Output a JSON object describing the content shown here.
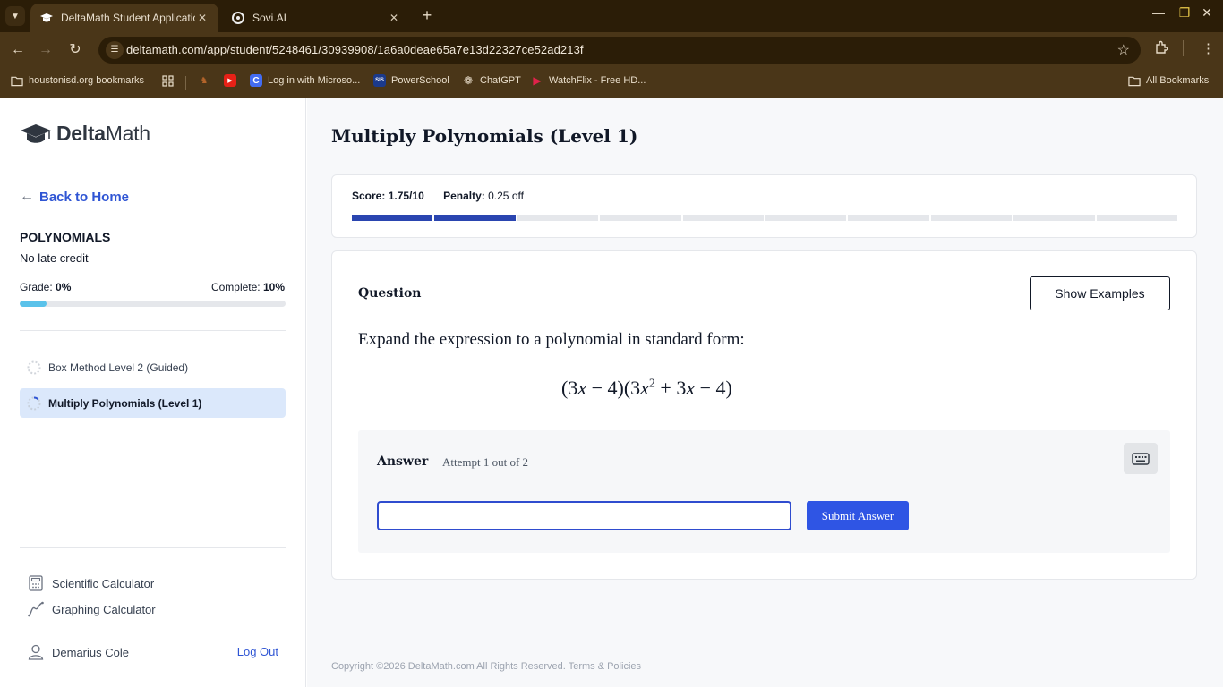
{
  "browser": {
    "tabs": [
      {
        "title": "DeltaMath Student Application",
        "active": true,
        "icon": "graduation-cap-icon"
      },
      {
        "title": "Sovi.AI",
        "active": false,
        "icon": "sovi-logo-icon"
      }
    ],
    "new_tab": "+",
    "url": "deltamath.com/app/student/5248461/30939908/1a6a0deae65a7e13d22327ce52ad213f",
    "bookmarks": [
      {
        "label": "houstonisd.org bookmarks",
        "icon": "folder-icon"
      },
      {
        "label": "",
        "icon": "apps-grid-icon"
      },
      {
        "label": "",
        "icon": "deer-icon"
      },
      {
        "label": "",
        "icon": "youtube-icon"
      },
      {
        "label": "Log in with Microso...",
        "icon": "clever-icon"
      },
      {
        "label": "PowerSchool",
        "icon": "sis-icon"
      },
      {
        "label": "ChatGPT",
        "icon": "openai-icon"
      },
      {
        "label": "WatchFlix - Free HD...",
        "icon": "watchflix-icon"
      }
    ],
    "all_bookmarks": "All Bookmarks"
  },
  "sidebar": {
    "logo_text_bold": "Delta",
    "logo_text_rest": "Math",
    "back_label": "Back to Home",
    "unit_title": "POLYNOMIALS",
    "late_credit": "No late credit",
    "grade_label": "Grade: ",
    "grade_value": "0%",
    "complete_label": "Complete: ",
    "complete_value": "10%",
    "complete_fraction": 0.1,
    "assignments": [
      {
        "label": "Box Method Level 2 (Guided)",
        "active": false
      },
      {
        "label": "Multiply Polynomials (Level 1)",
        "active": true
      }
    ],
    "tools": [
      {
        "label": "Scientific Calculator",
        "icon": "calculator-icon"
      },
      {
        "label": "Graphing Calculator",
        "icon": "graph-icon"
      }
    ],
    "user_name": "Demarius Cole",
    "logout_label": "Log Out"
  },
  "main": {
    "title": "Multiply Polynomials (Level 1)",
    "score_label": "Score:",
    "score_value": "1.75/10",
    "penalty_label": "Penalty:",
    "penalty_value": "0.25 off",
    "segments_total": 10,
    "segments_done": 2,
    "question_label": "Question",
    "show_examples": "Show Examples",
    "prompt": "Expand the expression to a polynomial in standard form:",
    "expression": {
      "part1": "(3",
      "var1": "x",
      "part2": " − 4)(3",
      "var2": "x",
      "exp": "2",
      "part3": " + 3",
      "var3": "x",
      "part4": " − 4)"
    },
    "answer_label": "Answer",
    "attempt_text": "Attempt 1 out of 2",
    "answer_value": "",
    "submit_label": "Submit Answer",
    "footer_prefix": "Copyright ©2026 DeltaMath.com All Rights Reserved. ",
    "footer_link": "Terms & Policies"
  },
  "colors": {
    "accent": "#2f55e4",
    "progress": "#5ac2ea",
    "segment_done": "#2a45b0",
    "chrome": "#4a3618"
  }
}
